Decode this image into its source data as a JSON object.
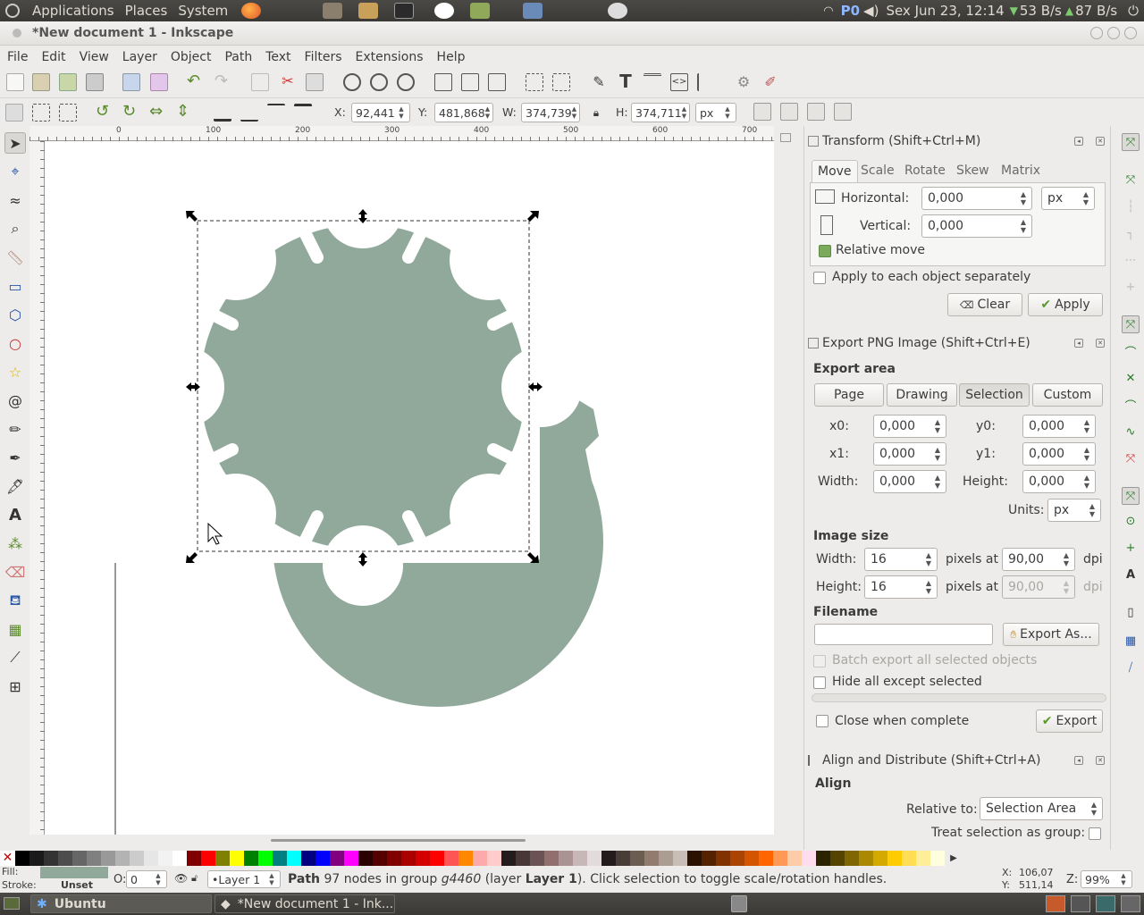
{
  "top_panel": {
    "menus": [
      "Applications",
      "Places",
      "System"
    ],
    "indicators": {
      "keyboard": "P0",
      "datetime": "Sex Jun 23, 12:14",
      "net_down": "53 B/s",
      "net_up": "87 B/s"
    }
  },
  "window": {
    "title": "*New document 1 - Inkscape"
  },
  "menubar": [
    "File",
    "Edit",
    "View",
    "Layer",
    "Object",
    "Path",
    "Text",
    "Filters",
    "Extensions",
    "Help"
  ],
  "control_bar": {
    "x_label": "X:",
    "x_value": "92,441",
    "y_label": "Y:",
    "y_value": "481,868",
    "w_label": "W:",
    "w_value": "374,739",
    "h_label": "H:",
    "h_value": "374,711",
    "unit": "px"
  },
  "ruler": {
    "h_ticks": [
      "0",
      "100",
      "200",
      "300",
      "400",
      "500",
      "600",
      "700"
    ]
  },
  "transform": {
    "title": "Transform (Shift+Ctrl+M)",
    "tabs": [
      "Move",
      "Scale",
      "Rotate",
      "Skew",
      "Matrix"
    ],
    "horizontal_label": "Horizontal:",
    "horizontal_value": "0,000",
    "vertical_label": "Vertical:",
    "vertical_value": "0,000",
    "unit": "px",
    "relative_move": "Relative move",
    "apply_each": "Apply to each object separately",
    "clear": "Clear",
    "apply": "Apply"
  },
  "export_png": {
    "title": "Export PNG Image (Shift+Ctrl+E)",
    "export_area": "Export area",
    "area_buttons": [
      "Page",
      "Drawing",
      "Selection",
      "Custom"
    ],
    "x0_label": "x0:",
    "x0": "0,000",
    "y0_label": "y0:",
    "y0": "0,000",
    "x1_label": "x1:",
    "x1": "0,000",
    "y1_label": "y1:",
    "y1": "0,000",
    "width_label": "Width:",
    "width": "0,000",
    "height_label": "Height:",
    "height": "0,000",
    "units_label": "Units:",
    "units": "px",
    "image_size": "Image size",
    "img_width_label": "Width:",
    "img_width": "16",
    "img_height_label": "Height:",
    "img_height": "16",
    "pixels_at": "pixels at",
    "dpi_value": "90,00",
    "dpi_value2": "90,00",
    "dpi": "dpi",
    "filename": "Filename",
    "filename_value": "",
    "export_as": "Export As...",
    "batch": "Batch export all selected objects",
    "hide_all": "Hide all except selected",
    "close_when": "Close when complete",
    "export": "Export"
  },
  "align": {
    "title": "Align and Distribute (Shift+Ctrl+A)",
    "align_heading": "Align",
    "relative_to_label": "Relative to:",
    "relative_to": "Selection Area",
    "treat_group": "Treat selection as group:"
  },
  "status": {
    "fill_label": "Fill:",
    "stroke_label": "Stroke:",
    "stroke_value": "Unset",
    "opacity_label": "O:",
    "opacity": "0",
    "layer": "•Layer 1",
    "message_prefix": "Path",
    "message_body": " 97 nodes in group ",
    "message_group": "g4460",
    "message_layer_pre": " (layer ",
    "message_layer": "Layer 1",
    "message_suffix": "). Click selection to toggle scale/rotation handles.",
    "cx_label": "X:",
    "cx": "106,07",
    "cy_label": "Y:",
    "cy": "511,14",
    "zoom_label": "Z:",
    "zoom": "99%"
  },
  "taskbar": {
    "items": [
      "Ubuntu",
      "*New document 1 - Ink..."
    ]
  },
  "colors": {
    "shape_fill": "#90a99b",
    "accent_green": "#7bab5a"
  }
}
